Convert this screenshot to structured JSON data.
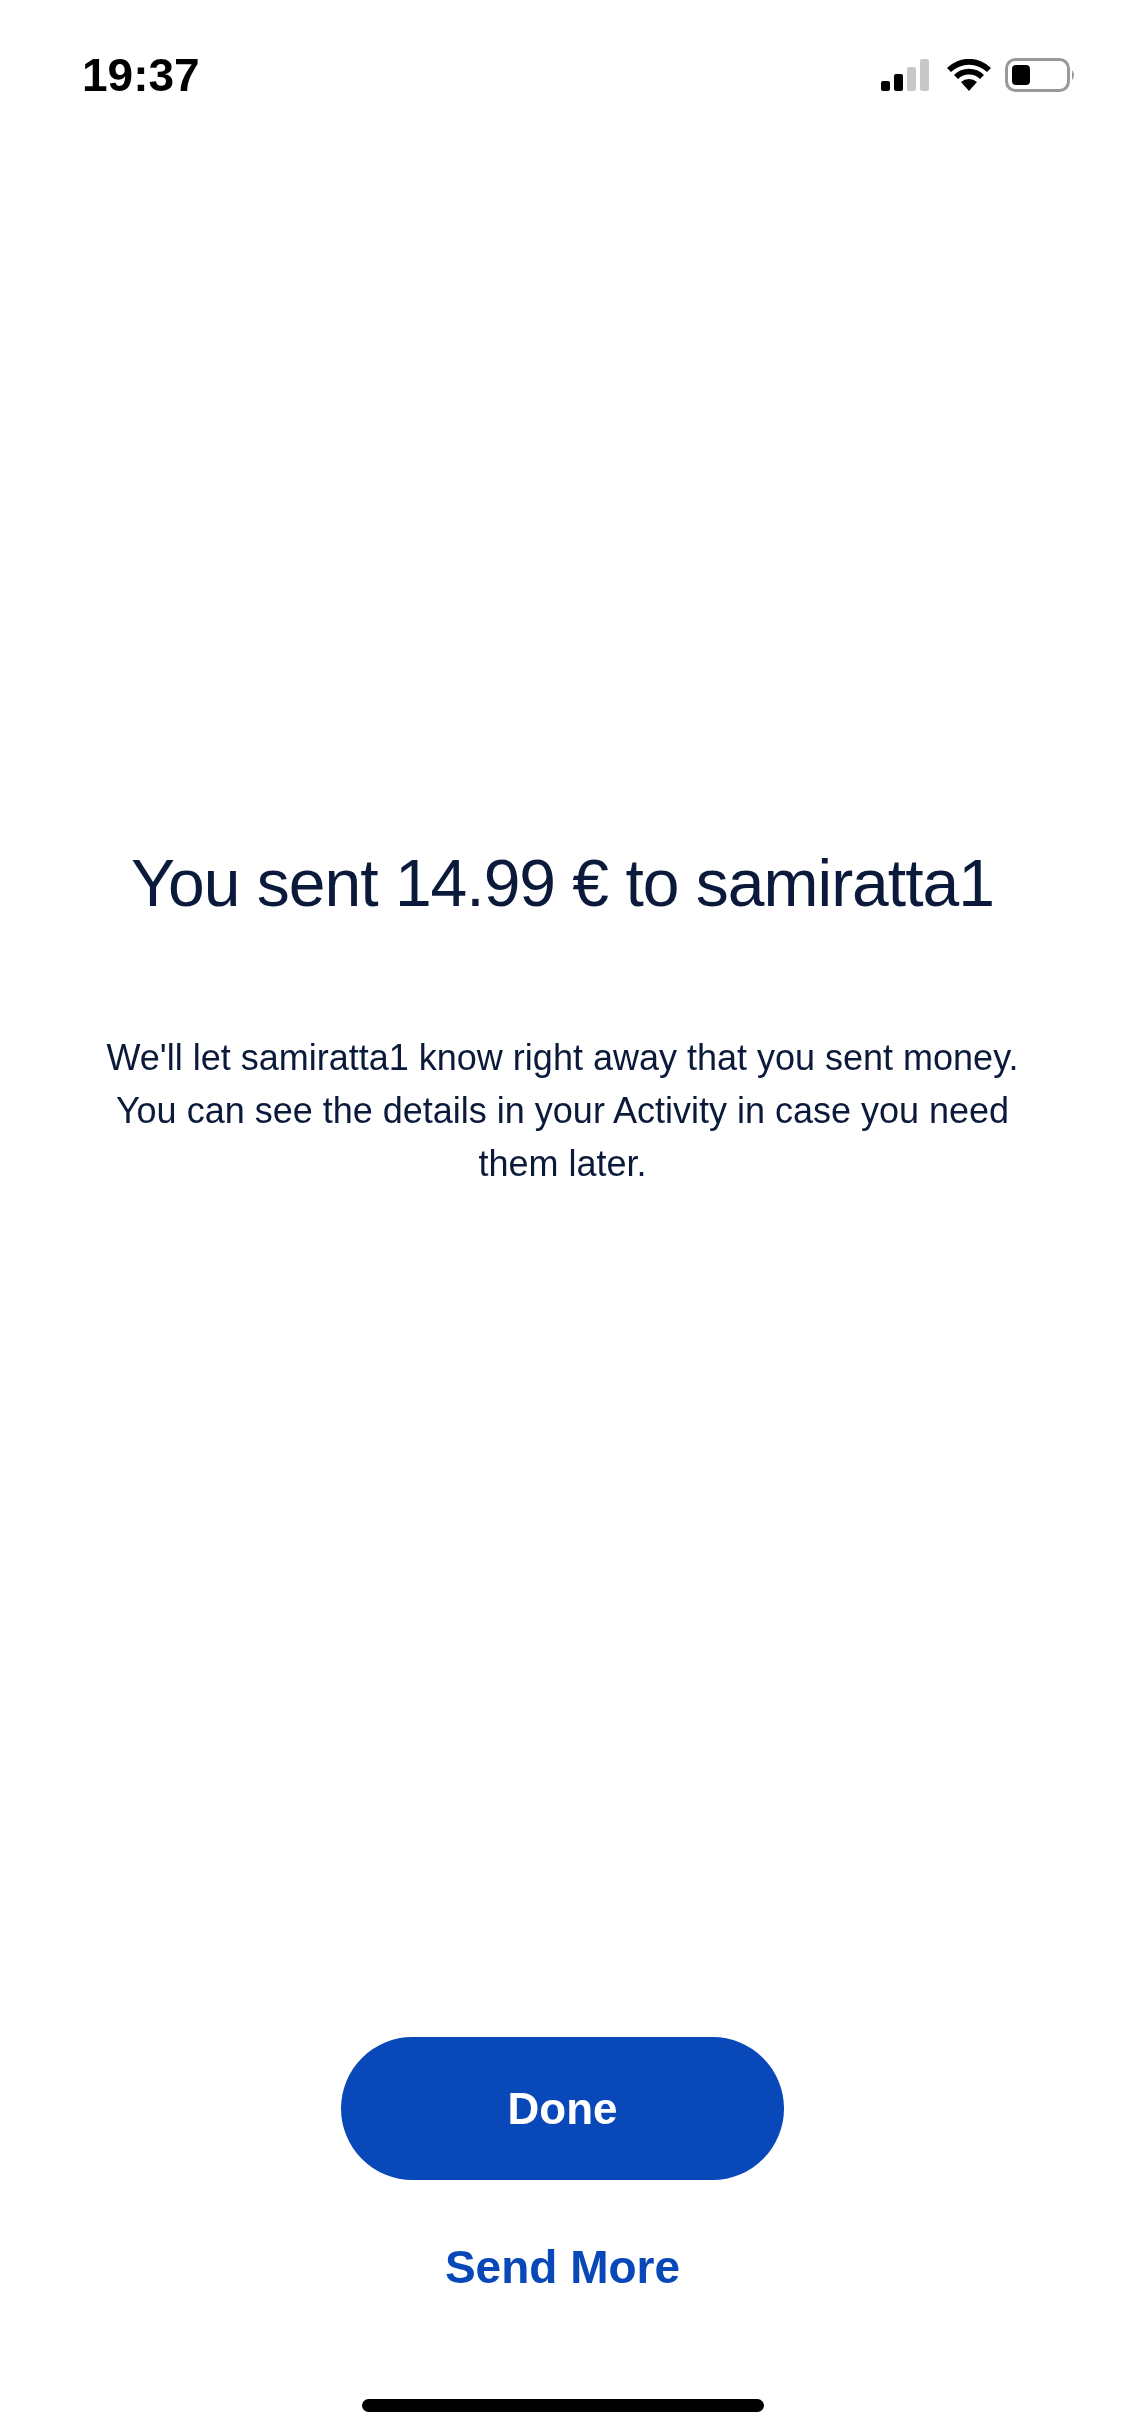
{
  "status_bar": {
    "time": "19:37"
  },
  "title": "You sent 14.99 € to samiratta1",
  "message": "We'll let samiratta1 know right away that you sent money. You can see the details in your Activity in case you need them later.",
  "buttons": [
    {
      "kind": "primary",
      "label": "Done"
    },
    {
      "kind": "link",
      "label": "Send More"
    }
  ]
}
